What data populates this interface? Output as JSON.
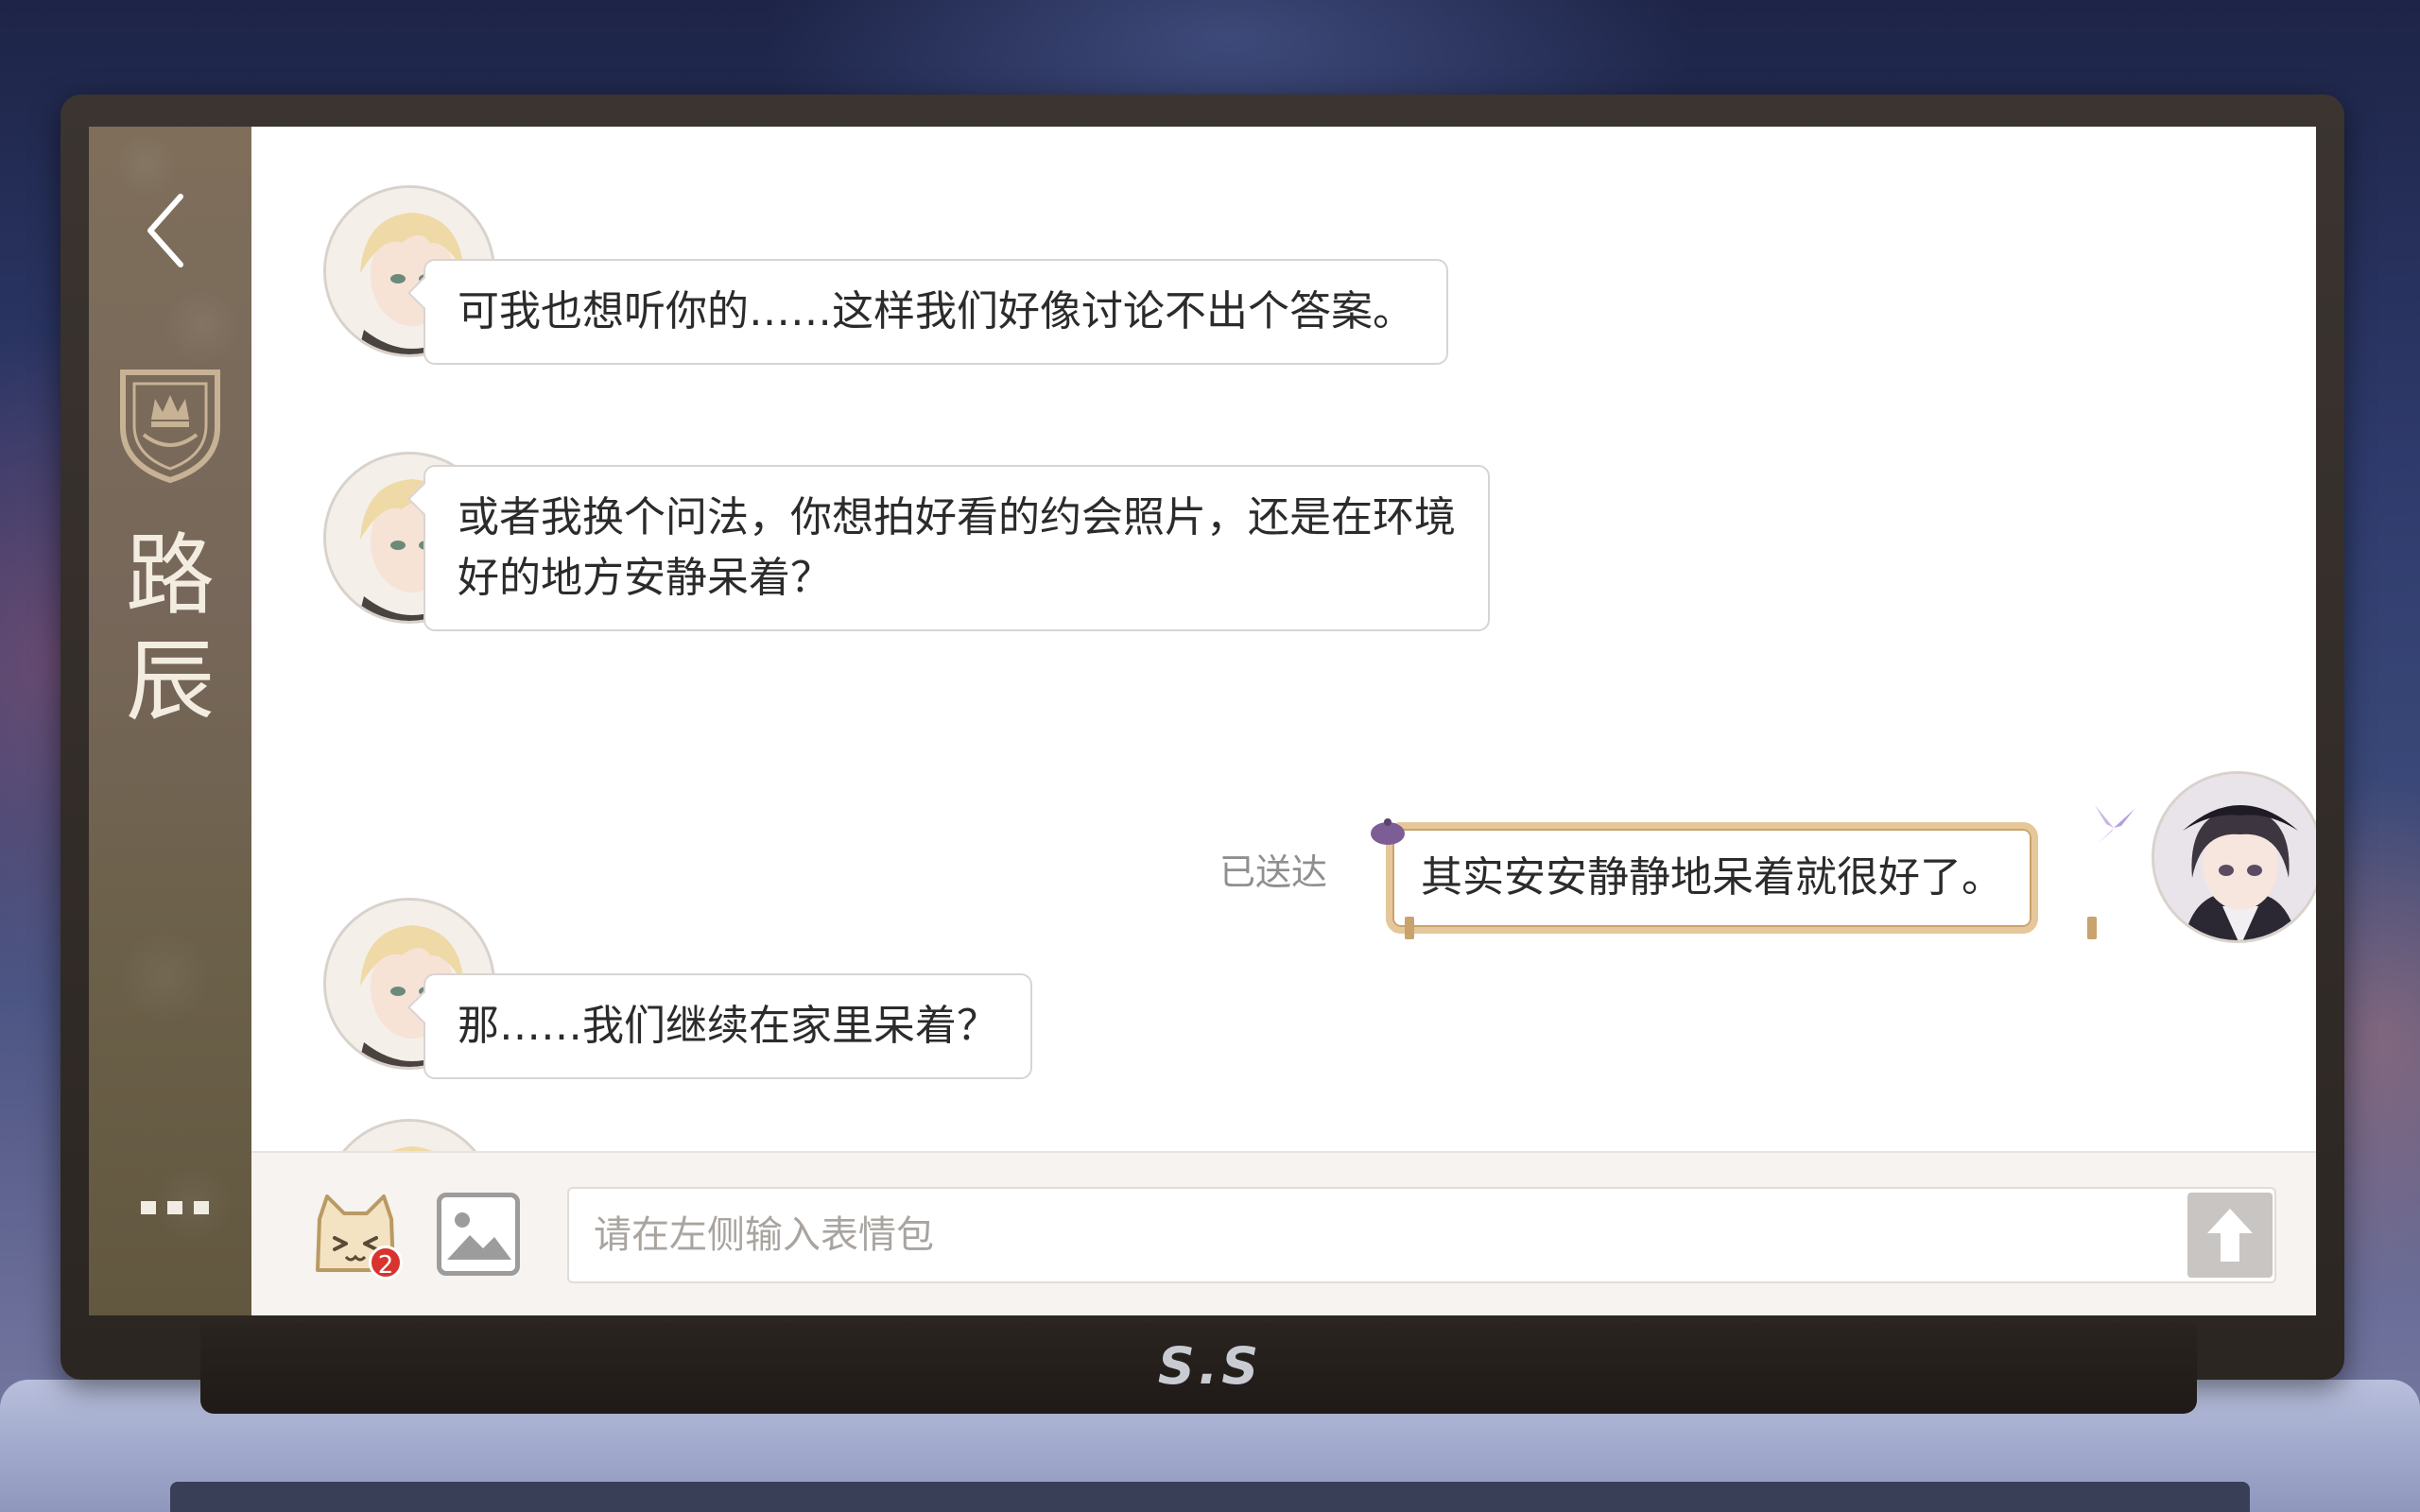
{
  "contact": {
    "name_line1": "路",
    "name_line2": "辰"
  },
  "messages": [
    {
      "sender": "contact",
      "text": "可我也想听你的……这样我们好像讨论不出个答案。"
    },
    {
      "sender": "contact",
      "line1": "或者我换个问法，你想拍好看的约会照片，还是在环境",
      "line2": "好的地方安静呆着？"
    },
    {
      "sender": "me",
      "text": "其实安安静静地呆着就很好了。",
      "status": "已送达"
    },
    {
      "sender": "contact",
      "text": "那……我们继续在家里呆着？"
    }
  ],
  "input": {
    "placeholder": "请在左侧输入表情包",
    "sticker_badge": "2"
  },
  "device": {
    "brand": "S.S"
  },
  "icons": [
    "back-arrow-icon",
    "school-crest-icon",
    "more-dots-icon",
    "cat-sticker-icon",
    "image-icon",
    "send-arrow-icon"
  ],
  "colors": {
    "sidebar": "#77675a",
    "my_bubble_border": "#e6c79a",
    "badge": "#d8342f"
  }
}
